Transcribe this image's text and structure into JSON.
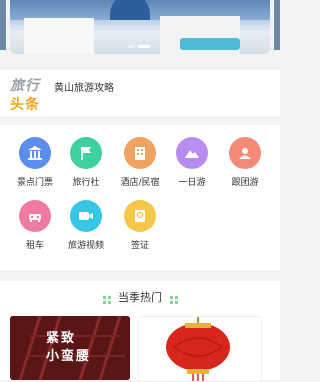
{
  "news": {
    "logo_top": "旅行",
    "logo_bottom": "头条",
    "headline": "黄山旅游攻略"
  },
  "services": [
    {
      "label": "景点门票",
      "icon": "temple-icon",
      "color": "#5b8def"
    },
    {
      "label": "旅行社",
      "icon": "flag-icon",
      "color": "#3fd0a0"
    },
    {
      "label": "酒店/民宿",
      "icon": "hotel-icon",
      "color": "#f0a35e"
    },
    {
      "label": "一日游",
      "icon": "mountain-icon",
      "color": "#b98cf0"
    },
    {
      "label": "跟团游",
      "icon": "group-icon",
      "color": "#f58a78"
    },
    {
      "label": "租车",
      "icon": "car-icon",
      "color": "#f07ba0"
    },
    {
      "label": "旅游视频",
      "icon": "video-icon",
      "color": "#38c6e6"
    },
    {
      "label": "签证",
      "icon": "visa-icon",
      "color": "#f5c84a"
    }
  ],
  "season": {
    "title": "当季热门",
    "card1_text_line1": "紧致",
    "card1_text_line2": "小蛮腰"
  }
}
